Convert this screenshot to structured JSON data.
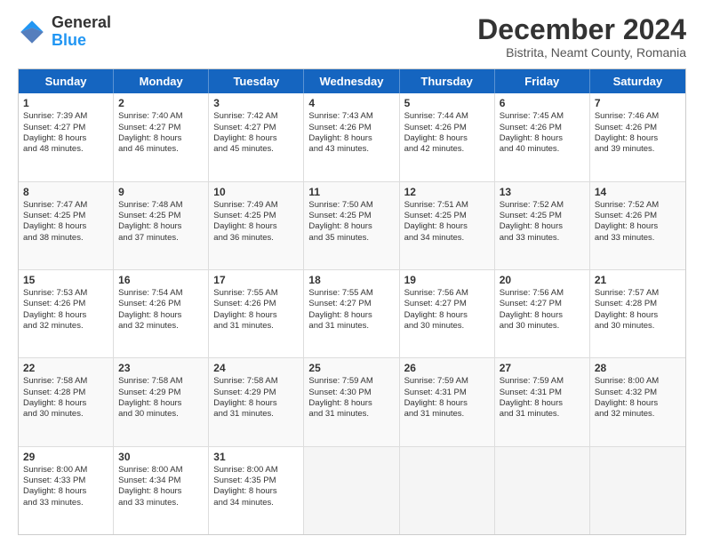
{
  "header": {
    "logo_general": "General",
    "logo_blue": "Blue",
    "title": "December 2024",
    "subtitle": "Bistrita, Neamt County, Romania"
  },
  "days": [
    "Sunday",
    "Monday",
    "Tuesday",
    "Wednesday",
    "Thursday",
    "Friday",
    "Saturday"
  ],
  "rows": [
    [
      {
        "day": "1",
        "lines": [
          "Sunrise: 7:39 AM",
          "Sunset: 4:27 PM",
          "Daylight: 8 hours",
          "and 48 minutes."
        ]
      },
      {
        "day": "2",
        "lines": [
          "Sunrise: 7:40 AM",
          "Sunset: 4:27 PM",
          "Daylight: 8 hours",
          "and 46 minutes."
        ]
      },
      {
        "day": "3",
        "lines": [
          "Sunrise: 7:42 AM",
          "Sunset: 4:27 PM",
          "Daylight: 8 hours",
          "and 45 minutes."
        ]
      },
      {
        "day": "4",
        "lines": [
          "Sunrise: 7:43 AM",
          "Sunset: 4:26 PM",
          "Daylight: 8 hours",
          "and 43 minutes."
        ]
      },
      {
        "day": "5",
        "lines": [
          "Sunrise: 7:44 AM",
          "Sunset: 4:26 PM",
          "Daylight: 8 hours",
          "and 42 minutes."
        ]
      },
      {
        "day": "6",
        "lines": [
          "Sunrise: 7:45 AM",
          "Sunset: 4:26 PM",
          "Daylight: 8 hours",
          "and 40 minutes."
        ]
      },
      {
        "day": "7",
        "lines": [
          "Sunrise: 7:46 AM",
          "Sunset: 4:26 PM",
          "Daylight: 8 hours",
          "and 39 minutes."
        ]
      }
    ],
    [
      {
        "day": "8",
        "lines": [
          "Sunrise: 7:47 AM",
          "Sunset: 4:25 PM",
          "Daylight: 8 hours",
          "and 38 minutes."
        ]
      },
      {
        "day": "9",
        "lines": [
          "Sunrise: 7:48 AM",
          "Sunset: 4:25 PM",
          "Daylight: 8 hours",
          "and 37 minutes."
        ]
      },
      {
        "day": "10",
        "lines": [
          "Sunrise: 7:49 AM",
          "Sunset: 4:25 PM",
          "Daylight: 8 hours",
          "and 36 minutes."
        ]
      },
      {
        "day": "11",
        "lines": [
          "Sunrise: 7:50 AM",
          "Sunset: 4:25 PM",
          "Daylight: 8 hours",
          "and 35 minutes."
        ]
      },
      {
        "day": "12",
        "lines": [
          "Sunrise: 7:51 AM",
          "Sunset: 4:25 PM",
          "Daylight: 8 hours",
          "and 34 minutes."
        ]
      },
      {
        "day": "13",
        "lines": [
          "Sunrise: 7:52 AM",
          "Sunset: 4:25 PM",
          "Daylight: 8 hours",
          "and 33 minutes."
        ]
      },
      {
        "day": "14",
        "lines": [
          "Sunrise: 7:52 AM",
          "Sunset: 4:26 PM",
          "Daylight: 8 hours",
          "and 33 minutes."
        ]
      }
    ],
    [
      {
        "day": "15",
        "lines": [
          "Sunrise: 7:53 AM",
          "Sunset: 4:26 PM",
          "Daylight: 8 hours",
          "and 32 minutes."
        ]
      },
      {
        "day": "16",
        "lines": [
          "Sunrise: 7:54 AM",
          "Sunset: 4:26 PM",
          "Daylight: 8 hours",
          "and 32 minutes."
        ]
      },
      {
        "day": "17",
        "lines": [
          "Sunrise: 7:55 AM",
          "Sunset: 4:26 PM",
          "Daylight: 8 hours",
          "and 31 minutes."
        ]
      },
      {
        "day": "18",
        "lines": [
          "Sunrise: 7:55 AM",
          "Sunset: 4:27 PM",
          "Daylight: 8 hours",
          "and 31 minutes."
        ]
      },
      {
        "day": "19",
        "lines": [
          "Sunrise: 7:56 AM",
          "Sunset: 4:27 PM",
          "Daylight: 8 hours",
          "and 30 minutes."
        ]
      },
      {
        "day": "20",
        "lines": [
          "Sunrise: 7:56 AM",
          "Sunset: 4:27 PM",
          "Daylight: 8 hours",
          "and 30 minutes."
        ]
      },
      {
        "day": "21",
        "lines": [
          "Sunrise: 7:57 AM",
          "Sunset: 4:28 PM",
          "Daylight: 8 hours",
          "and 30 minutes."
        ]
      }
    ],
    [
      {
        "day": "22",
        "lines": [
          "Sunrise: 7:58 AM",
          "Sunset: 4:28 PM",
          "Daylight: 8 hours",
          "and 30 minutes."
        ]
      },
      {
        "day": "23",
        "lines": [
          "Sunrise: 7:58 AM",
          "Sunset: 4:29 PM",
          "Daylight: 8 hours",
          "and 30 minutes."
        ]
      },
      {
        "day": "24",
        "lines": [
          "Sunrise: 7:58 AM",
          "Sunset: 4:29 PM",
          "Daylight: 8 hours",
          "and 31 minutes."
        ]
      },
      {
        "day": "25",
        "lines": [
          "Sunrise: 7:59 AM",
          "Sunset: 4:30 PM",
          "Daylight: 8 hours",
          "and 31 minutes."
        ]
      },
      {
        "day": "26",
        "lines": [
          "Sunrise: 7:59 AM",
          "Sunset: 4:31 PM",
          "Daylight: 8 hours",
          "and 31 minutes."
        ]
      },
      {
        "day": "27",
        "lines": [
          "Sunrise: 7:59 AM",
          "Sunset: 4:31 PM",
          "Daylight: 8 hours",
          "and 31 minutes."
        ]
      },
      {
        "day": "28",
        "lines": [
          "Sunrise: 8:00 AM",
          "Sunset: 4:32 PM",
          "Daylight: 8 hours",
          "and 32 minutes."
        ]
      }
    ],
    [
      {
        "day": "29",
        "lines": [
          "Sunrise: 8:00 AM",
          "Sunset: 4:33 PM",
          "Daylight: 8 hours",
          "and 33 minutes."
        ]
      },
      {
        "day": "30",
        "lines": [
          "Sunrise: 8:00 AM",
          "Sunset: 4:34 PM",
          "Daylight: 8 hours",
          "and 33 minutes."
        ]
      },
      {
        "day": "31",
        "lines": [
          "Sunrise: 8:00 AM",
          "Sunset: 4:35 PM",
          "Daylight: 8 hours",
          "and 34 minutes."
        ]
      },
      {
        "day": "",
        "lines": []
      },
      {
        "day": "",
        "lines": []
      },
      {
        "day": "",
        "lines": []
      },
      {
        "day": "",
        "lines": []
      }
    ]
  ]
}
